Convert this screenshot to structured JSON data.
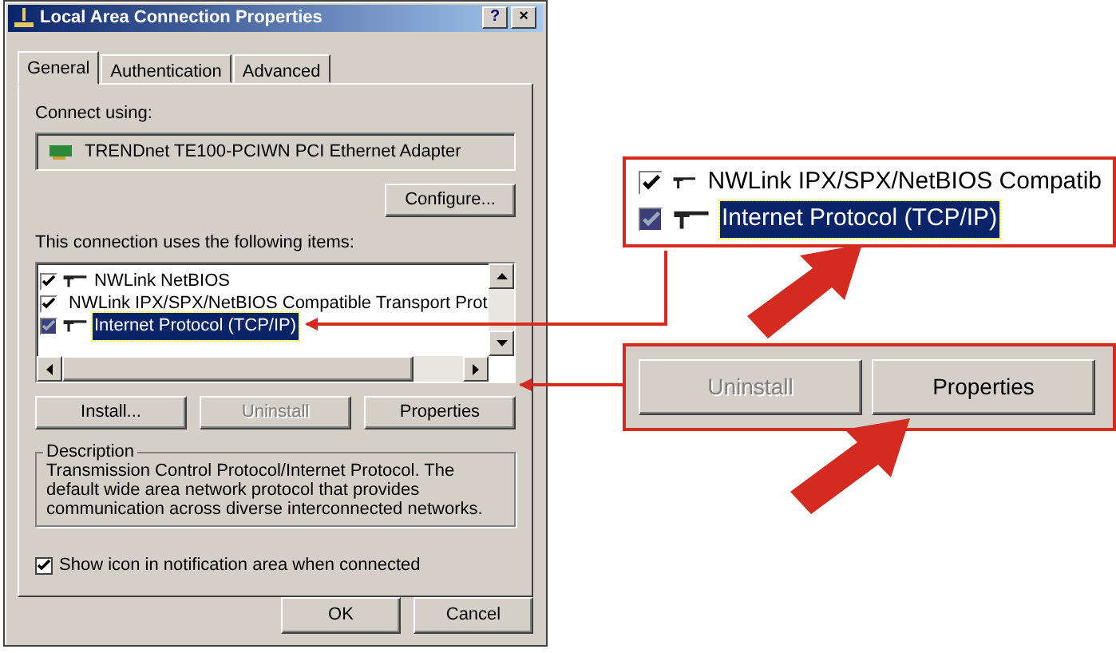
{
  "window": {
    "title": "Local Area Connection Properties",
    "buttons": [
      {
        "kind": "help",
        "label": "?"
      },
      {
        "kind": "close",
        "label": "×"
      }
    ]
  },
  "tabs": [
    {
      "label": "General",
      "selected": true
    },
    {
      "label": "Authentication",
      "selected": false
    },
    {
      "label": "Advanced",
      "selected": false
    }
  ],
  "connect_using": {
    "label": "Connect using:",
    "adapter": "TRENDnet TE100-PCIWN PCI Ethernet Adapter",
    "button": "Configure..."
  },
  "items": {
    "label": "This connection uses the following items:",
    "rows": [
      {
        "name": "NWLink NetBIOS",
        "checked": true,
        "selected": false
      },
      {
        "name": "NWLink IPX/SPX/NetBIOS Compatible Transport Prot",
        "checked": true,
        "selected": false
      },
      {
        "name": "Internet Protocol (TCP/IP)",
        "checked": true,
        "selected": true
      }
    ]
  },
  "actions": [
    {
      "label": "Install...",
      "disabled": false
    },
    {
      "label": "Uninstall",
      "disabled": true
    },
    {
      "label": "Properties",
      "disabled": false
    }
  ],
  "description": {
    "title": "Description",
    "text": "Transmission Control Protocol/Internet Protocol. The default wide area network protocol that provides communication across diverse interconnected networks."
  },
  "show_icon": {
    "label": "Show icon in notification area when connected",
    "checked": true
  },
  "footer_buttons": [
    {
      "label": "OK"
    },
    {
      "label": "Cancel"
    }
  ],
  "callouts": [
    {
      "kind": "items",
      "rows": [
        {
          "name": "NWLink IPX/SPX/NetBIOS Compatib",
          "checked": true,
          "selected": false
        },
        {
          "name": "Internet Protocol (TCP/IP)",
          "checked": true,
          "selected": true
        }
      ]
    },
    {
      "kind": "buttons",
      "buttons": [
        {
          "label": "Uninstall",
          "disabled": true
        },
        {
          "label": "Properties",
          "disabled": false
        }
      ]
    }
  ]
}
